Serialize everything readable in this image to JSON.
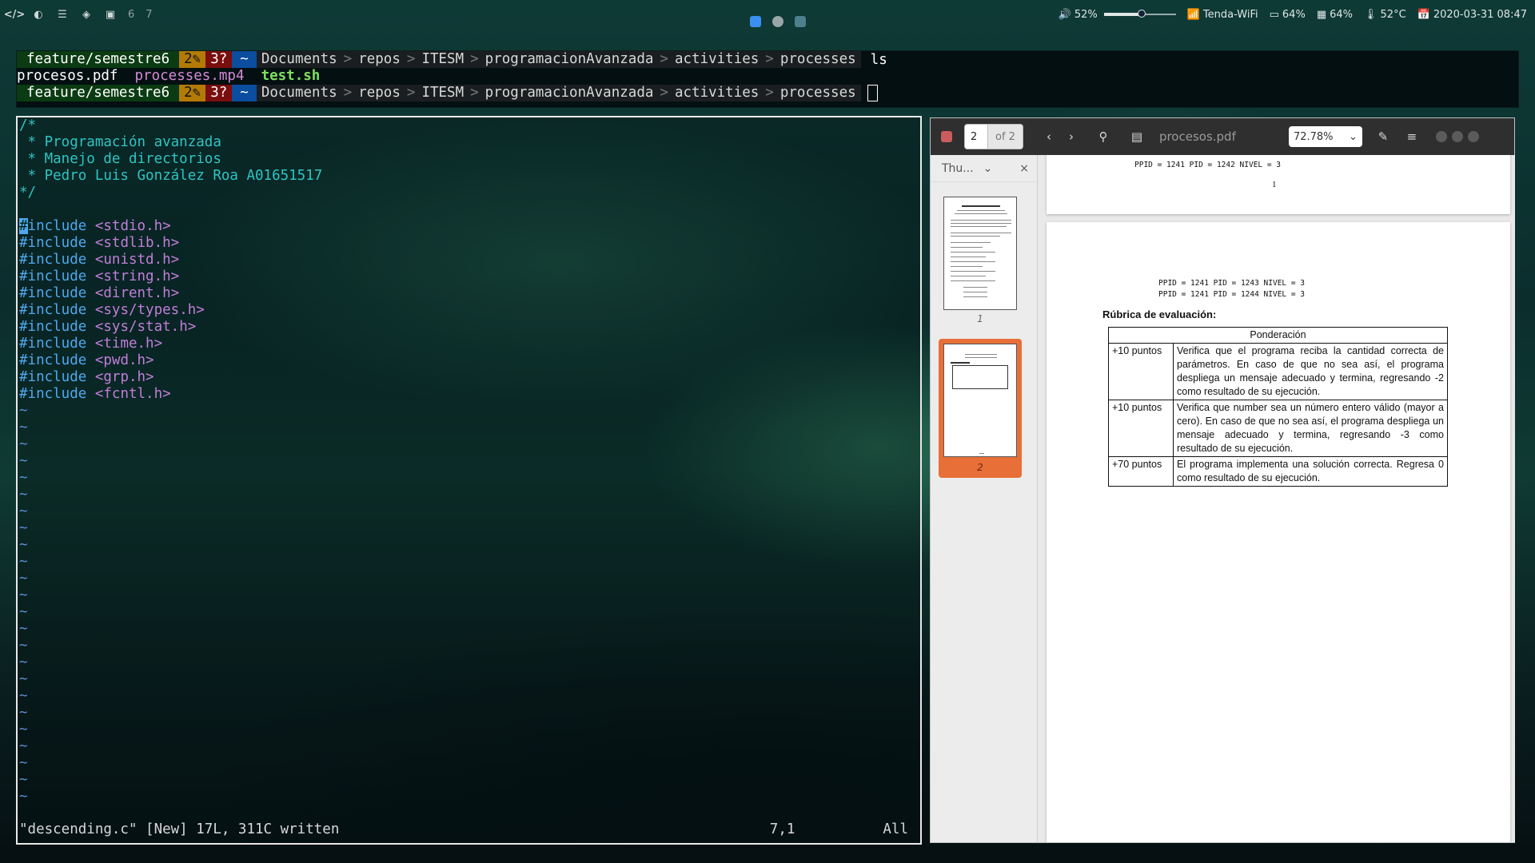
{
  "topbar": {
    "left_icons": [
      "code-icon",
      "circle-icon",
      "spotify-icon",
      "diamond-icon",
      "layout-icon"
    ],
    "workspaces": [
      "6",
      "7"
    ],
    "center_tray": [
      "zoom-icon",
      "settings-icon",
      "image-icon"
    ],
    "volume": {
      "label": "52%",
      "level": 0.52
    },
    "wifi": "Tenda-WiFi",
    "battery": "64%",
    "memory": "64%",
    "temperature": "52°C",
    "datetime": "2020-03-31 08:47"
  },
  "terminal": {
    "prompt": {
      "branch": "feature/semestre6",
      "modified": "2✎",
      "untracked": "3?",
      "home": "~",
      "path": [
        "Documents",
        "repos",
        "ITESM",
        "programacionAvanzada",
        "activities",
        "processes"
      ]
    },
    "command1": "ls",
    "ls_output": [
      "procesos.pdf",
      "processes.mp4",
      "test.sh"
    ]
  },
  "vim": {
    "comment_lines": [
      "/*",
      " * Programación avanzada",
      " * Manejo de directorios",
      " * Pedro Luis González Roa A01651517",
      "*/"
    ],
    "include_keyword": "#include",
    "includes": [
      "<stdio.h>",
      "<stdlib.h>",
      "<unistd.h>",
      "<string.h>",
      "<dirent.h>",
      "<sys/types.h>",
      "<sys/stat.h>",
      "<time.h>",
      "<pwd.h>",
      "<grp.h>",
      "<fcntl.h>"
    ],
    "tilde": "~",
    "status_message": "\"descending.c\" [New] 17L, 311C written",
    "cursor_pos": "7,1",
    "scroll": "All"
  },
  "pdf_viewer": {
    "current_page": "2",
    "page_of": "of 2",
    "title": "procesos.pdf",
    "zoom": "72.78%",
    "sidebar_mode": "Thu...",
    "thumbnail_labels": [
      "1",
      "2"
    ],
    "page1_tail": [
      "PPID = 1241 PID = 1242 NIVEL = 3"
    ],
    "page1_number": "1",
    "page2_lines": [
      "PPID = 1241 PID = 1243 NIVEL = 3",
      "PPID = 1241 PID = 1244 NIVEL = 3"
    ],
    "rubric_title": "Rúbrica de evaluación:",
    "rubric_header": "Ponderación",
    "rubric_rows": [
      {
        "points": "+10 puntos",
        "desc": "Verifica que el programa reciba la cantidad correcta de parámetros. En caso de que no sea así, el programa despliega un mensaje adecuado y termina, regresando -2 como resultado de su ejecución."
      },
      {
        "points": "+10 puntos",
        "desc": "Verifica que number sea un número entero válido (mayor a cero). En caso de que no sea así, el programa despliega un mensaje adecuado y termina, regresando -3 como resultado de su ejecución."
      },
      {
        "points": "+70 puntos",
        "desc": "El programa implementa una solución correcta. Regresa 0 como resultado de su ejecución."
      }
    ]
  },
  "colors": {
    "accent_orange": "#e86f37",
    "branch_bg": "#0b3b12",
    "modified_bg": "#b37b06",
    "untracked_bg": "#7a0d0d",
    "home_bg": "#0b4d9e"
  }
}
